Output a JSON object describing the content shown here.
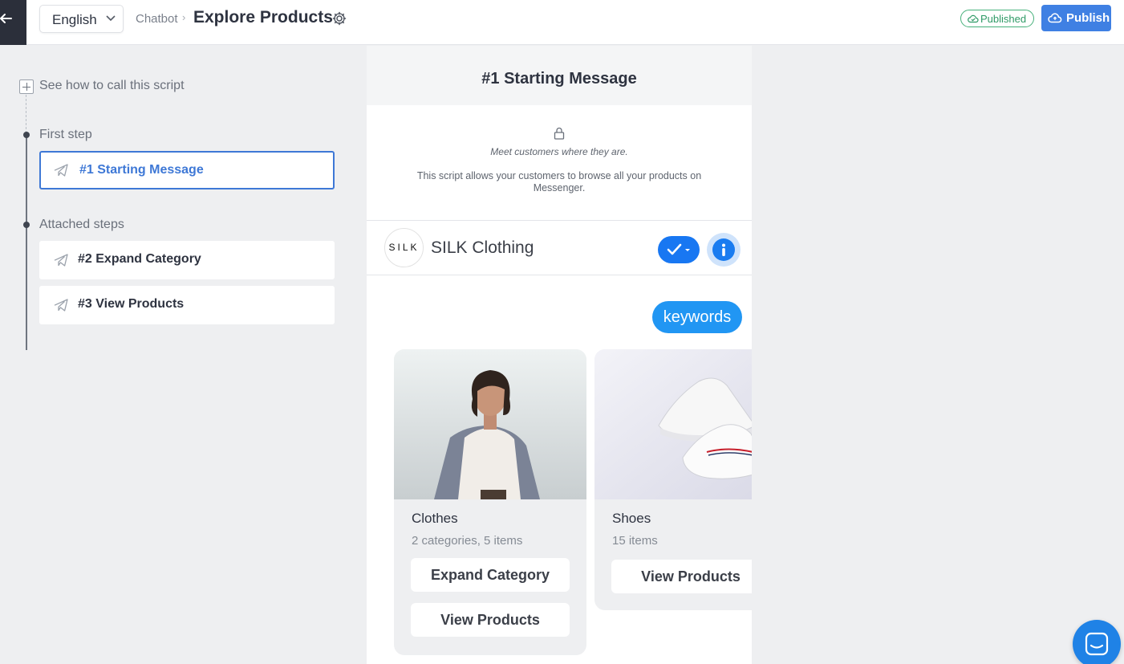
{
  "header": {
    "language": "English",
    "breadcrumb_parent": "Chatbot",
    "breadcrumb_sep": "›",
    "title": "Explore Products",
    "status_badge": "Published",
    "publish_label": "Publish"
  },
  "sidebar": {
    "how_to_label": "See how to call this script",
    "first_step_label": "First step",
    "attached_steps_label": "Attached steps",
    "steps": [
      {
        "label": "#1 Starting Message",
        "active": true
      },
      {
        "label": "#2 Expand Category",
        "active": false
      },
      {
        "label": "#3 View Products",
        "active": false
      }
    ]
  },
  "preview": {
    "title": "#1 Starting Message",
    "intro_italic": "Meet customers where they are.",
    "intro_description": "This script allows your customers to browse all your products on Messenger.",
    "brand_logo_text": "SILK",
    "brand_name": "SILK Clothing",
    "user_bubble": "keywords",
    "cards": [
      {
        "title": "Clothes",
        "subtitle": "2 categories, 5 items",
        "buttons": [
          "Expand Category",
          "View Products"
        ]
      },
      {
        "title": "Shoes",
        "subtitle": "15 items",
        "buttons": [
          "View Products"
        ]
      }
    ]
  },
  "icons": {
    "back": "arrow-left-icon",
    "language_dropdown": "chevron-down-icon",
    "settings": "gear-icon",
    "published": "cloud-check-icon",
    "publish": "cloud-icon",
    "step": "paper-plane-icon",
    "lock": "lock-icon",
    "verified": "check-icon",
    "info": "info-icon",
    "chat": "chat-icon"
  },
  "colors": {
    "accent": "#3e78d6",
    "publish_bg": "#3f80e3",
    "published_green": "#2f9a66",
    "messenger_blue": "#2196f3",
    "dark_sidebar": "#2b2f3a"
  }
}
